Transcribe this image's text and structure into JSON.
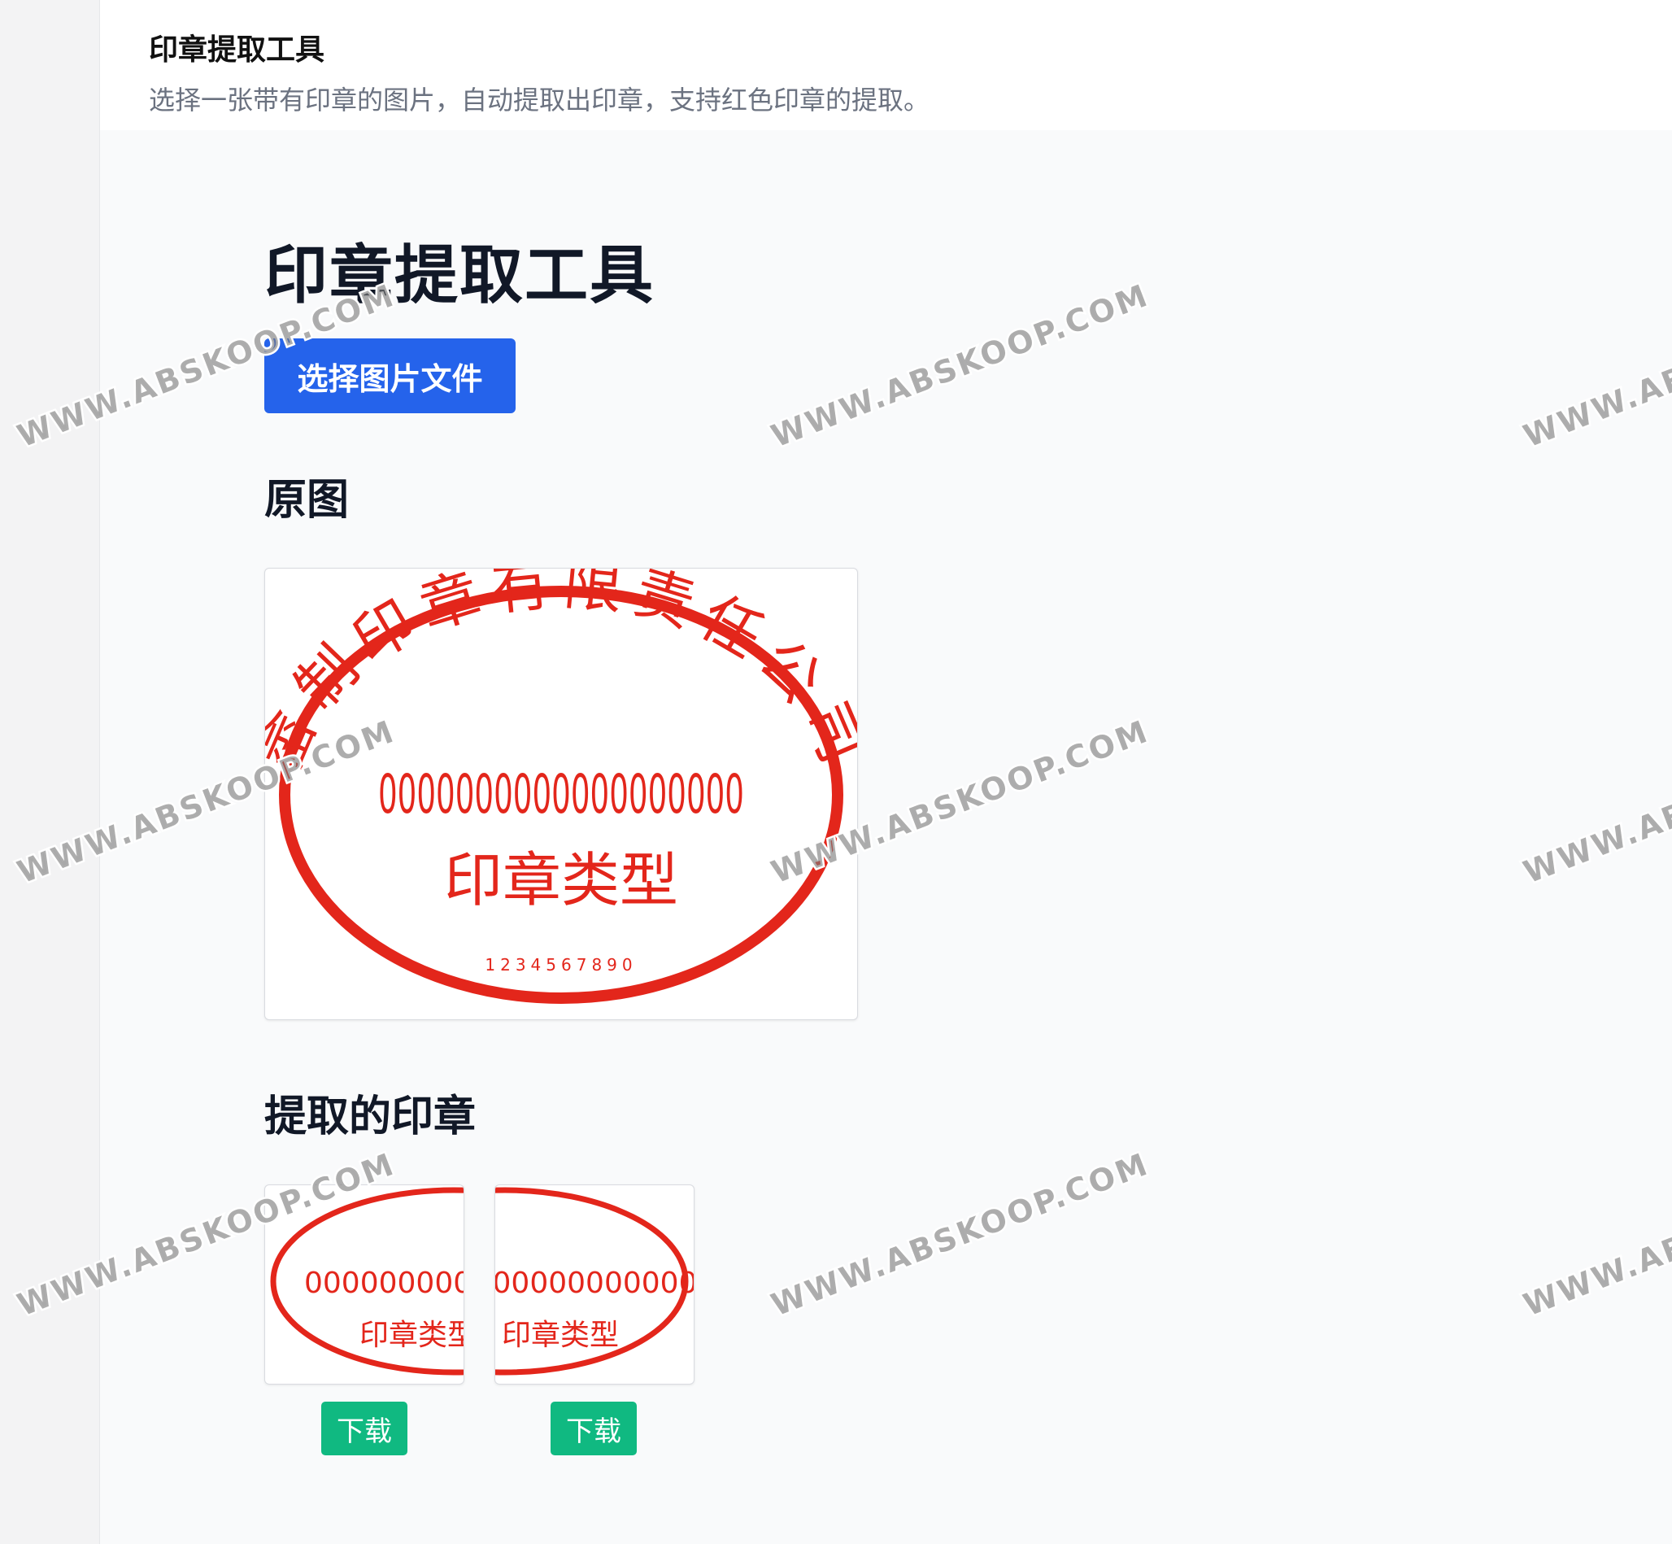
{
  "header": {
    "title": "印章提取工具",
    "description": "选择一张带有印章的图片，自动提取出印章，支持红色印章的提取。"
  },
  "main": {
    "title": "印章提取工具",
    "select_button_label": "选择图片文件",
    "original_section_title": "原图",
    "extracted_section_title": "提取的印章",
    "extracted": [
      {
        "download_label": "下载"
      },
      {
        "download_label": "下载"
      }
    ]
  },
  "seal": {
    "arc_text": "畲制印章有限责任公司",
    "code": "0000000000000000000",
    "type": "印章类型",
    "serial": "1234567890",
    "color": "#e3261b"
  },
  "watermark": {
    "text": "WWW.ABSKOOP.COM"
  },
  "colors": {
    "primary_button": "#2563eb",
    "download_button": "#10b981"
  }
}
